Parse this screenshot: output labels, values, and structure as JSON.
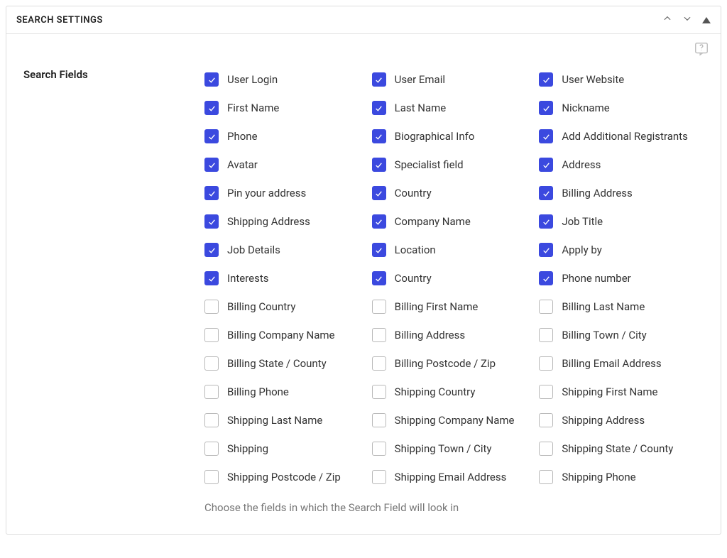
{
  "panel": {
    "title": "SEARCH SETTINGS"
  },
  "section": {
    "label": "Search Fields",
    "helper": "Choose the fields in which the Search Field will look in"
  },
  "fields": [
    {
      "label": "User Login",
      "checked": true
    },
    {
      "label": "User Email",
      "checked": true
    },
    {
      "label": "User Website",
      "checked": true
    },
    {
      "label": "First Name",
      "checked": true
    },
    {
      "label": "Last Name",
      "checked": true
    },
    {
      "label": "Nickname",
      "checked": true
    },
    {
      "label": "Phone",
      "checked": true
    },
    {
      "label": "Biographical Info",
      "checked": true
    },
    {
      "label": "Add Additional Registrants",
      "checked": true
    },
    {
      "label": "Avatar",
      "checked": true
    },
    {
      "label": "Specialist field",
      "checked": true
    },
    {
      "label": "Address",
      "checked": true
    },
    {
      "label": "Pin your address",
      "checked": true
    },
    {
      "label": "Country",
      "checked": true
    },
    {
      "label": "Billing Address",
      "checked": true
    },
    {
      "label": "Shipping Address",
      "checked": true
    },
    {
      "label": "Company Name",
      "checked": true
    },
    {
      "label": "Job Title",
      "checked": true
    },
    {
      "label": "Job Details",
      "checked": true
    },
    {
      "label": "Location",
      "checked": true
    },
    {
      "label": "Apply by",
      "checked": true
    },
    {
      "label": "Interests",
      "checked": true
    },
    {
      "label": "Country",
      "checked": true
    },
    {
      "label": "Phone number",
      "checked": true
    },
    {
      "label": "Billing Country",
      "checked": false
    },
    {
      "label": "Billing First Name",
      "checked": false
    },
    {
      "label": "Billing Last Name",
      "checked": false
    },
    {
      "label": "Billing Company Name",
      "checked": false
    },
    {
      "label": "Billing Address",
      "checked": false
    },
    {
      "label": "Billing Town / City",
      "checked": false
    },
    {
      "label": "Billing State / County",
      "checked": false
    },
    {
      "label": "Billing Postcode / Zip",
      "checked": false
    },
    {
      "label": "Billing Email Address",
      "checked": false
    },
    {
      "label": "Billing Phone",
      "checked": false
    },
    {
      "label": "Shipping Country",
      "checked": false
    },
    {
      "label": "Shipping First Name",
      "checked": false
    },
    {
      "label": "Shipping Last Name",
      "checked": false
    },
    {
      "label": "Shipping Company Name",
      "checked": false
    },
    {
      "label": "Shipping Address",
      "checked": false
    },
    {
      "label": "Shipping",
      "checked": false
    },
    {
      "label": "Shipping Town / City",
      "checked": false
    },
    {
      "label": "Shipping State / County",
      "checked": false
    },
    {
      "label": "Shipping Postcode / Zip",
      "checked": false
    },
    {
      "label": "Shipping Email Address",
      "checked": false
    },
    {
      "label": "Shipping Phone",
      "checked": false
    }
  ]
}
